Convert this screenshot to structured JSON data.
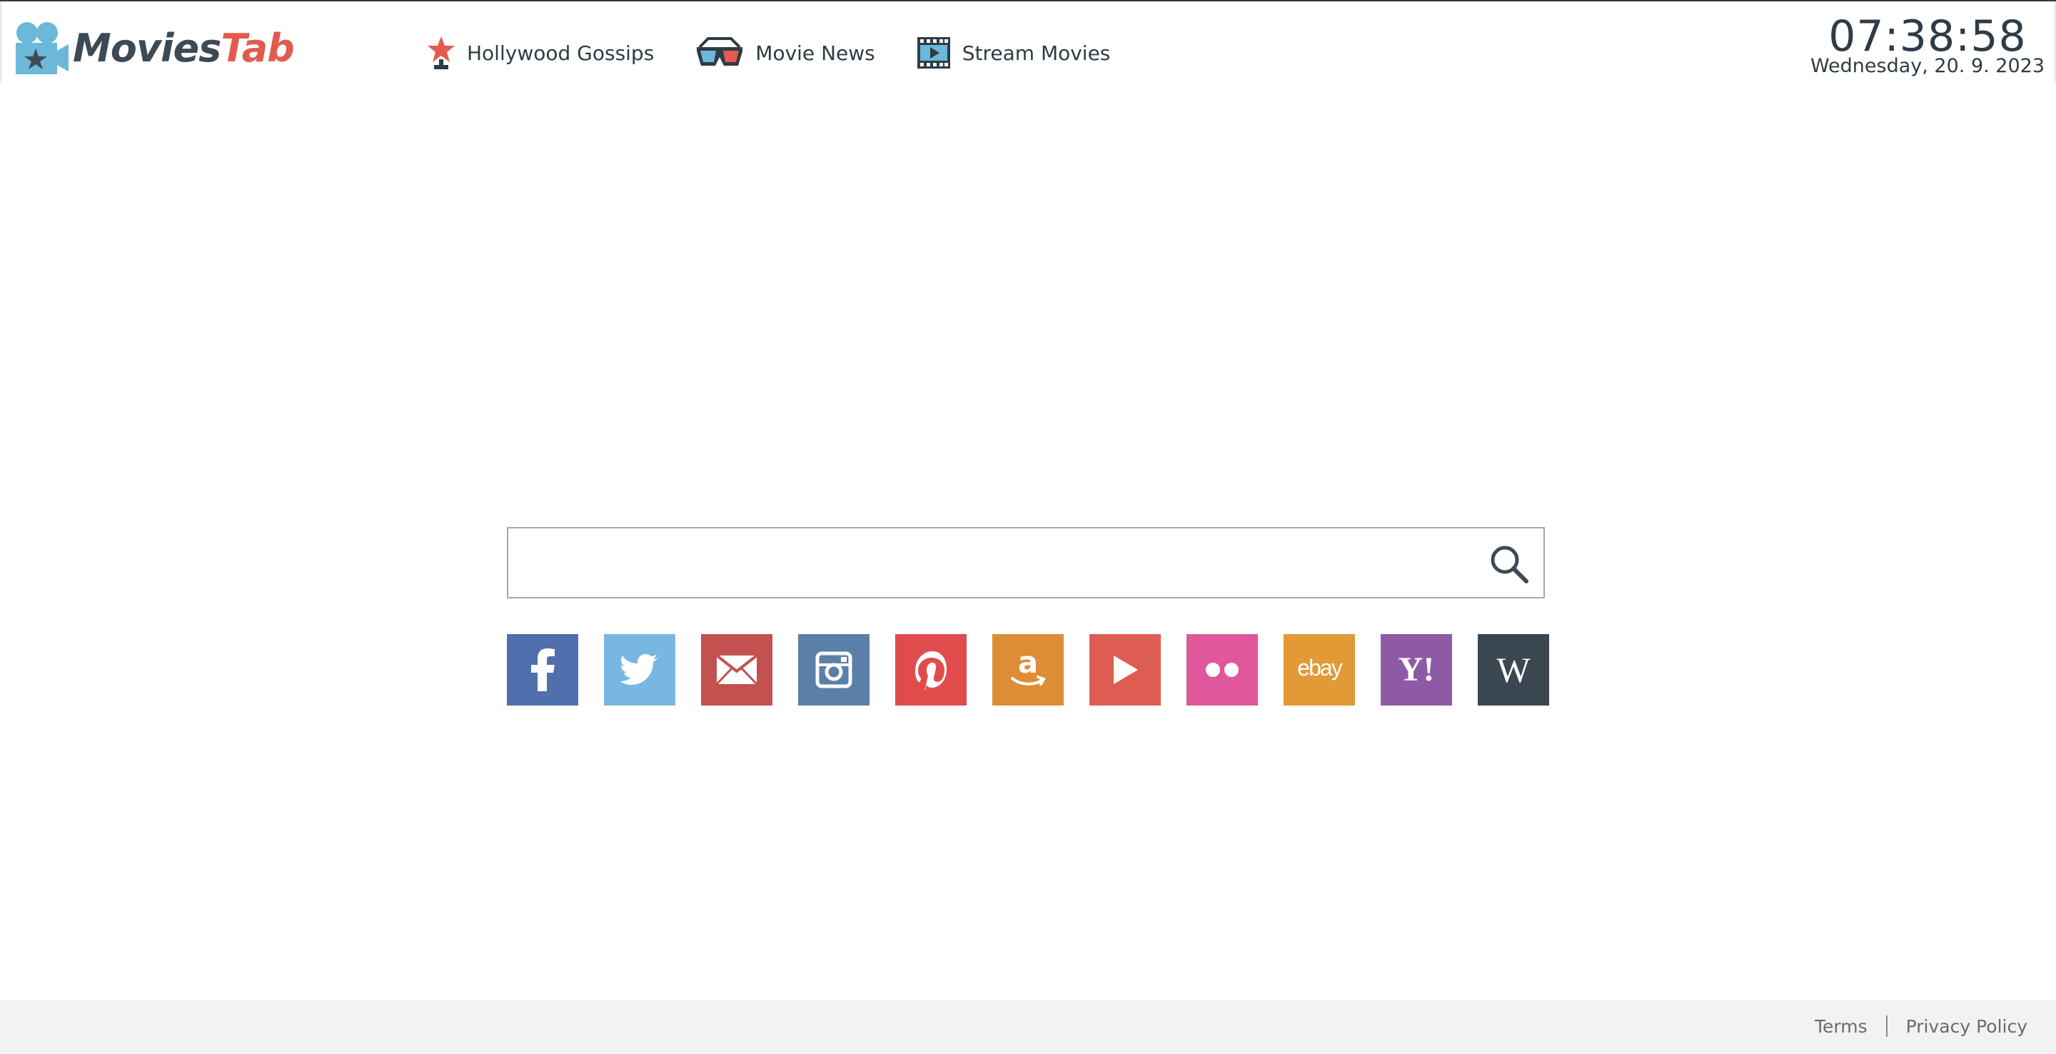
{
  "brand": {
    "name_part1": "Movies",
    "name_part2": "Tab",
    "color_primary": "#3d4a55",
    "color_accent": "#e35b4f",
    "logo_icon": "film-camera-icon"
  },
  "nav": {
    "items": [
      {
        "label": "Hollywood Gossips",
        "icon": "star-award-icon"
      },
      {
        "label": "Movie News",
        "icon": "3d-glasses-icon"
      },
      {
        "label": "Stream Movies",
        "icon": "film-strip-play-icon"
      }
    ]
  },
  "clock": {
    "time": "07:38:58",
    "date": "Wednesday, 20. 9. 2023"
  },
  "search": {
    "value": "",
    "placeholder": "",
    "icon": "search-icon"
  },
  "quick_links": [
    {
      "name": "Facebook",
      "icon": "facebook-icon",
      "color": "#4f6fad"
    },
    {
      "name": "Twitter",
      "icon": "twitter-icon",
      "color": "#79b7e3"
    },
    {
      "name": "Email",
      "icon": "mail-icon",
      "color": "#c3514f"
    },
    {
      "name": "Instagram",
      "icon": "instagram-icon",
      "color": "#5a7fa8"
    },
    {
      "name": "Pinterest",
      "icon": "pinterest-icon",
      "color": "#e04c4c"
    },
    {
      "name": "Amazon",
      "icon": "amazon-icon",
      "color": "#dc8d36"
    },
    {
      "name": "YouTube",
      "icon": "play-icon",
      "color": "#de5d53"
    },
    {
      "name": "Flickr",
      "icon": "flickr-icon",
      "color": "#e0579b"
    },
    {
      "name": "eBay",
      "icon": "ebay-icon",
      "color": "#e19a35",
      "glyph": "ebay"
    },
    {
      "name": "Yahoo",
      "icon": "yahoo-icon",
      "color": "#8e5aa6",
      "glyph": "Y!"
    },
    {
      "name": "Wikipedia",
      "icon": "wikipedia-icon",
      "color": "#3a4750",
      "glyph": "W"
    }
  ],
  "footer": {
    "terms": "Terms",
    "privacy": "Privacy Policy"
  }
}
